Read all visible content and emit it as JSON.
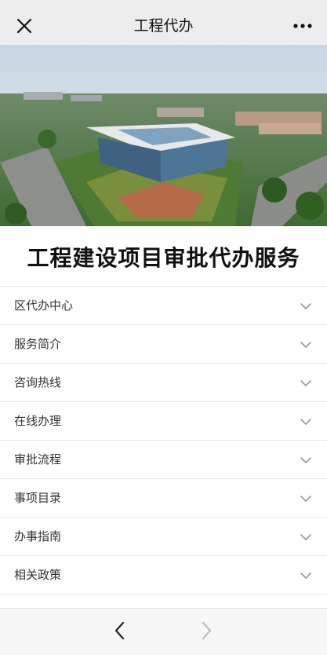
{
  "topbar": {
    "title": "工程代办",
    "close_icon": "close-icon",
    "more_icon": "more-icon"
  },
  "banner": {
    "image": "aerial-photo-of-government-service-center"
  },
  "headline": "工程建设项目审批代办服务",
  "menu": {
    "items": [
      {
        "label": "区代办中心"
      },
      {
        "label": "服务简介"
      },
      {
        "label": "咨询热线"
      },
      {
        "label": "在线办理"
      },
      {
        "label": "审批流程"
      },
      {
        "label": "事项目录"
      },
      {
        "label": "办事指南"
      },
      {
        "label": "相关政策"
      }
    ],
    "chevron_icon": "chevron-down-icon"
  },
  "bottombar": {
    "back_icon": "chevron-left-icon",
    "forward_icon": "chevron-right-icon"
  }
}
